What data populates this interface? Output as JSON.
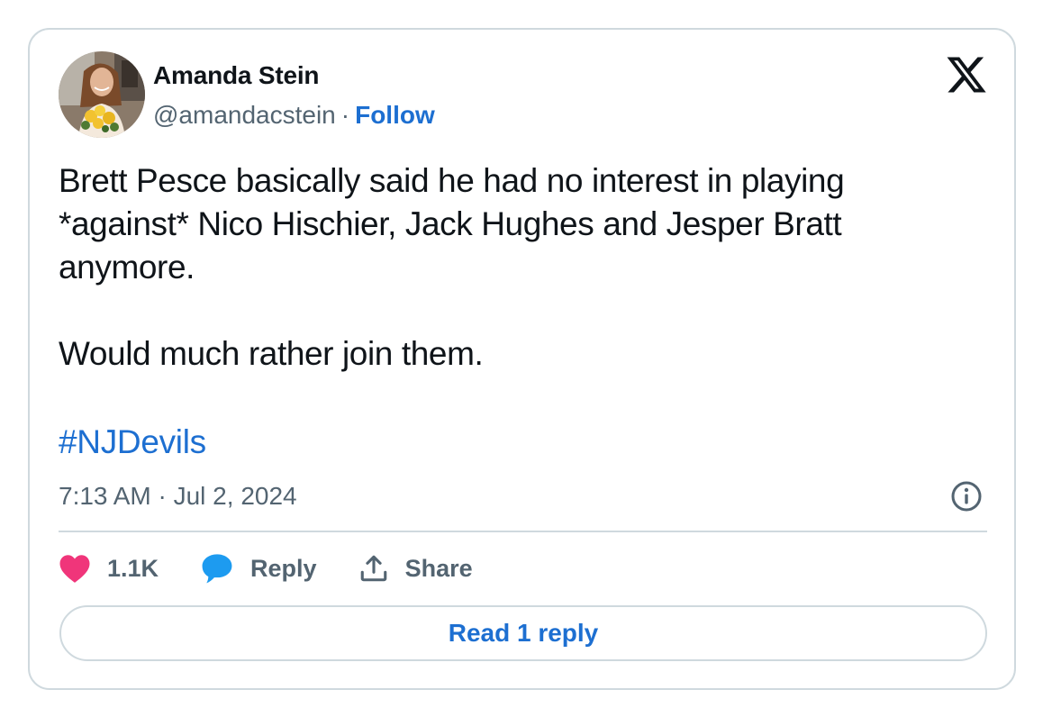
{
  "author": {
    "name": "Amanda Stein",
    "handle": "@amandacstein",
    "separator": "·",
    "follow_label": "Follow"
  },
  "tweet": {
    "paragraphs": [
      "Brett Pesce basically said he had no interest in playing *against* Nico Hischier, Jack Hughes and Jesper Bratt anymore.",
      "Would much rather join them."
    ],
    "hashtag": "#NJDevils",
    "timestamp": "7:13 AM · Jul 2, 2024"
  },
  "actions": {
    "likes_count": "1.1K",
    "reply_label": "Reply",
    "share_label": "Share"
  },
  "read_replies_label": "Read 1 reply",
  "icons": {
    "brand": "x-logo-icon",
    "info": "info-icon",
    "like": "heart-icon",
    "reply": "speech-bubble-icon",
    "share": "share-upload-icon"
  },
  "colors": {
    "link": "#1d6fd1",
    "muted_text": "#536471",
    "border": "#cfd9de",
    "heart": "#f0357a",
    "reply_bubble": "#1d9bf0"
  }
}
